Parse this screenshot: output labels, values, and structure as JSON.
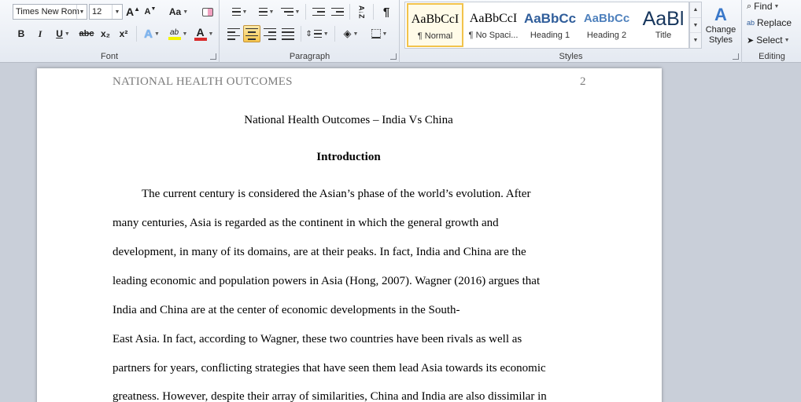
{
  "ribbon": {
    "font": {
      "label": "Font",
      "font_name": "Times New Rom",
      "font_size": "12",
      "grow_label": "A",
      "shrink_label": "A",
      "change_case_label": "Aa",
      "bold": "B",
      "italic": "I",
      "underline": "U",
      "strikethrough": "abc",
      "subscript": "x₂",
      "superscript": "x²",
      "text_effects": "A",
      "highlight": "ab",
      "font_color": "A",
      "font_color_hex": "#d82b2b",
      "highlight_hex": "#f5f500"
    },
    "paragraph": {
      "label": "Paragraph",
      "sort": "A↓Z",
      "pilcrow": "¶"
    },
    "styles": {
      "label": "Styles",
      "items": [
        {
          "sample": "AaBbCcI",
          "name": "¶ Normal"
        },
        {
          "sample": "AaBbCcI",
          "name": "¶ No Spaci..."
        },
        {
          "sample": "AaBbCc",
          "name": "Heading 1"
        },
        {
          "sample": "AaBbCc",
          "name": "Heading 2"
        },
        {
          "sample": "AaBl",
          "name": "Title"
        }
      ],
      "change_styles": "Change Styles"
    },
    "editing": {
      "label": "Editing",
      "find": "Find",
      "replace": "Replace",
      "select": "Select"
    }
  },
  "document": {
    "header": "NATIONAL HEALTH OUTCOMES",
    "page_number": "2",
    "title": "National Health Outcomes – India Vs China",
    "heading": "Introduction",
    "lines": [
      "The current century is considered the Asian’s phase of the world’s evolution. After",
      "many centuries, Asia is regarded as the continent in which the general growth and",
      "development, in many of its domains, are at their peaks. In fact, India and China are the",
      "leading economic and population powers in Asia (Hong, 2007). Wagner (2016) argues that",
      "India and China are at the center of economic  developments in  the South-",
      "East Asia. In fact, according to Wagner, these two countries have been rivals  as well as",
      "partners for years, conflicting strategies that have seen them lead Asia towards its economic",
      "greatness. However, despite their array of similarities,  China and India are also dissimilar in"
    ]
  }
}
